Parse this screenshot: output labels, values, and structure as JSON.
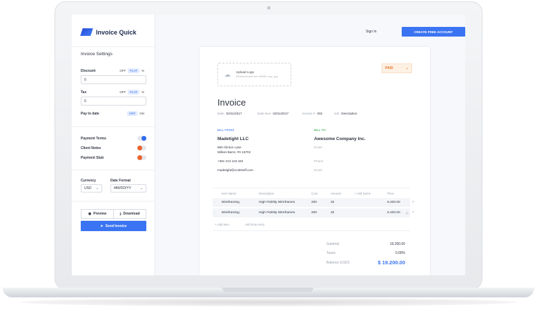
{
  "sidebar": {
    "app_name": "Invoice Quick",
    "section_title": "Invoice Settings",
    "discount": {
      "label": "Discount",
      "options": [
        "OFF",
        "FLAT",
        "%"
      ],
      "active": "FLAT",
      "value": "0"
    },
    "tax": {
      "label": "Tax",
      "options": [
        "OFF",
        "FLAT",
        "%"
      ],
      "active": "FLAT",
      "value": "0"
    },
    "pay_to_date": {
      "label": "Pay to date",
      "options": [
        "OFF",
        "ON"
      ],
      "active": "OFF"
    },
    "toggles": [
      {
        "label": "Payment Terms",
        "state": "on"
      },
      {
        "label": "Client Notes",
        "state": "off"
      },
      {
        "label": "Payment Stub",
        "state": "off"
      }
    ],
    "currency": {
      "label": "Currency",
      "value": "USD"
    },
    "date_format": {
      "label": "Date Format",
      "value": "MM/DD/YY"
    },
    "preview_label": "Preview",
    "download_label": "Download",
    "send_label": "Send Invoice"
  },
  "header": {
    "signin_label": "Sign In",
    "cta_label": "CREATE FREE ACCOUNT"
  },
  "invoice": {
    "upload_title": "Upload Logo",
    "upload_hint": "Recommended size 380x80. png , jpg",
    "status": "PAID",
    "title": "Invoice",
    "date_label": "Date",
    "date": "02/11/2017",
    "due_label": "Date Due",
    "due": "03/11/2017",
    "number_label": "Invoice #",
    "number": "002",
    "job_label": "Job",
    "job": "Description",
    "bill_from_label": "BILL FROM",
    "from_name": "Madetight LLC",
    "from_address1": "665 Clinton Lane",
    "from_address2": "Wilkes Barre, PA 18702",
    "from_phone": "+381 213 123 432",
    "from_email": "madetight@coolstuff.com",
    "bill_to_label": "BILL TO",
    "to_name": "Awesome Company Inc.",
    "to_email_placeholder": "Email",
    "to_phone_placeholder": "Phone",
    "to_email2_placeholder": "Email",
    "columns": [
      "Item Name",
      "Description",
      "Cost",
      "Amount",
      "+ Add Same",
      "Price"
    ],
    "items": [
      {
        "name": "Wireframing",
        "description": "High Fidelity Wireframes",
        "cost": "200",
        "amount": "32",
        "price": "6.400.00"
      },
      {
        "name": "Wireframing",
        "description": "High Fidelity Wireframes",
        "cost": "200",
        "amount": "32",
        "price": "6.400.00"
      }
    ],
    "add_item": "+ Add item",
    "add_time": "Add time entry",
    "subtotal_label": "Subtotal",
    "subtotal": "19.200.00",
    "taxes_label": "Taxes",
    "taxes": "0.00%",
    "balance_label": "Balance (USD)",
    "balance": "$ 19.200.00"
  },
  "colors": {
    "accent": "#3b74f2",
    "paid": "#e9782d",
    "bill_from": "#3b74f2",
    "bill_to": "#27a844",
    "off": "#e9632d"
  }
}
